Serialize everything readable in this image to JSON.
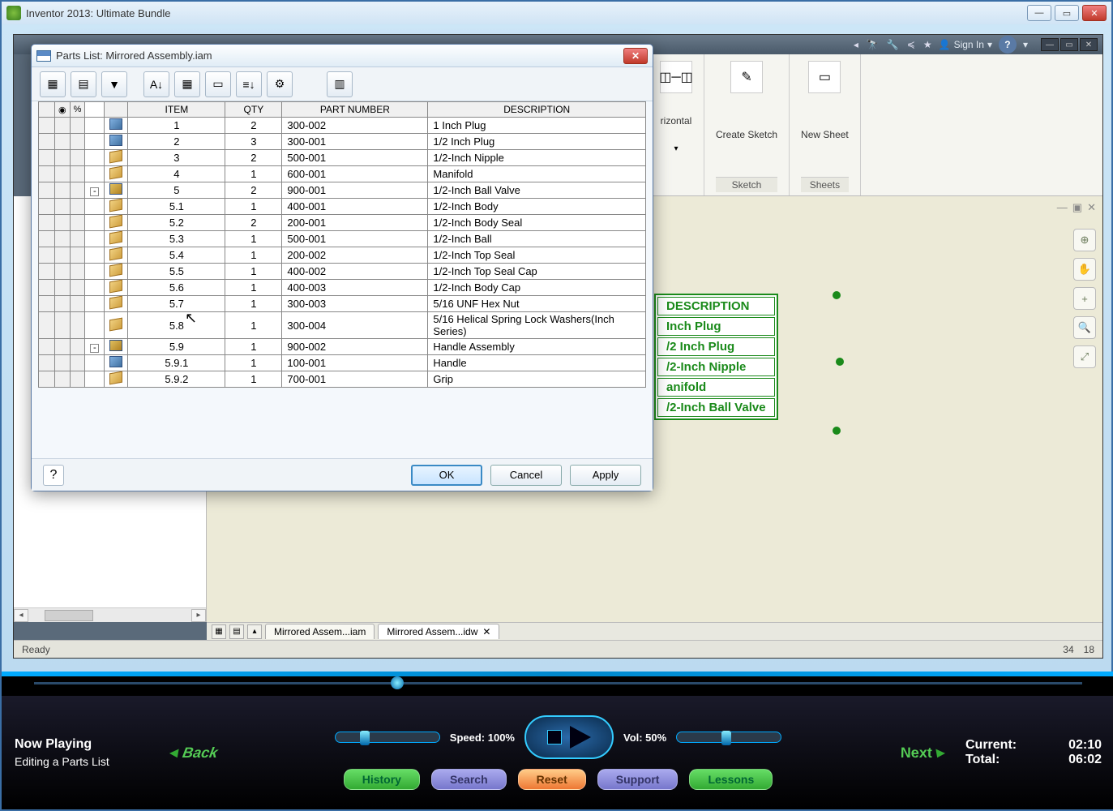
{
  "outer": {
    "title": "Inventor 2013: Ultimate Bundle"
  },
  "inner": {
    "signin": "Sign In",
    "ribbon": {
      "horizontal": "rizontal",
      "createSketch": "Create Sketch",
      "newSheet": "New Sheet",
      "sketchCat": "Sketch",
      "sheetsCat": "Sheets"
    },
    "tabs": {
      "t1": "Mirrored Assem...iam",
      "t2": "Mirrored Assem...idw"
    },
    "status": {
      "ready": "Ready",
      "c1": "34",
      "c2": "18"
    }
  },
  "dwg": {
    "header": "DESCRIPTION",
    "rows": [
      "Inch Plug",
      "/2 Inch Plug",
      "/2-Inch Nipple",
      "anifold",
      "/2-Inch Ball Valve"
    ]
  },
  "dialog": {
    "title": "Parts List: Mirrored Assembly.iam",
    "headers": {
      "item": "ITEM",
      "qty": "QTY",
      "pn": "PART NUMBER",
      "desc": "DESCRIPTION"
    },
    "rows": [
      {
        "exp": "",
        "iconType": "asm",
        "item": "1",
        "qty": "2",
        "pn": "300-002",
        "desc": "1 Inch Plug"
      },
      {
        "exp": "",
        "iconType": "asm",
        "item": "2",
        "qty": "3",
        "pn": "300-001",
        "desc": "1/2 Inch Plug"
      },
      {
        "exp": "",
        "iconType": "box",
        "item": "3",
        "qty": "2",
        "pn": "500-001",
        "desc": "1/2-Inch Nipple"
      },
      {
        "exp": "",
        "iconType": "box",
        "item": "4",
        "qty": "1",
        "pn": "600-001",
        "desc": "Manifold"
      },
      {
        "exp": "-",
        "iconType": "sub",
        "item": "5",
        "qty": "2",
        "pn": "900-001",
        "desc": "1/2-Inch Ball Valve"
      },
      {
        "exp": "",
        "iconType": "box",
        "item": "5.1",
        "qty": "1",
        "pn": "400-001",
        "desc": "1/2-Inch Body"
      },
      {
        "exp": "",
        "iconType": "box",
        "item": "5.2",
        "qty": "2",
        "pn": "200-001",
        "desc": "1/2-Inch Body Seal"
      },
      {
        "exp": "",
        "iconType": "box",
        "item": "5.3",
        "qty": "1",
        "pn": "500-001",
        "desc": "1/2-Inch Ball"
      },
      {
        "exp": "",
        "iconType": "box",
        "item": "5.4",
        "qty": "1",
        "pn": "200-002",
        "desc": "1/2-Inch Top Seal"
      },
      {
        "exp": "",
        "iconType": "box",
        "item": "5.5",
        "qty": "1",
        "pn": "400-002",
        "desc": "1/2-Inch Top Seal Cap"
      },
      {
        "exp": "",
        "iconType": "box",
        "item": "5.6",
        "qty": "1",
        "pn": "400-003",
        "desc": "1/2-Inch Body Cap"
      },
      {
        "exp": "",
        "iconType": "box",
        "item": "5.7",
        "qty": "1",
        "pn": "300-003",
        "desc": "5/16 UNF Hex Nut"
      },
      {
        "exp": "",
        "iconType": "box",
        "item": "5.8",
        "qty": "1",
        "pn": "300-004",
        "desc": "5/16  Helical Spring Lock Washers(Inch Series)"
      },
      {
        "exp": "-",
        "iconType": "sub",
        "item": "5.9",
        "qty": "1",
        "pn": "900-002",
        "desc": "Handle Assembly"
      },
      {
        "exp": "",
        "iconType": "asm",
        "item": "5.9.1",
        "qty": "1",
        "pn": "100-001",
        "desc": "Handle"
      },
      {
        "exp": "",
        "iconType": "box",
        "item": "5.9.2",
        "qty": "1",
        "pn": "700-001",
        "desc": "Grip"
      }
    ],
    "buttons": {
      "ok": "OK",
      "cancel": "Cancel",
      "apply": "Apply"
    }
  },
  "player": {
    "nowPlayingTitle": "Now Playing",
    "nowPlayingSub": "Editing a Parts List",
    "back": "Back",
    "next": "Next",
    "speedLabel": "Speed: 100%",
    "volLabel": "Vol: 50%",
    "buttons": {
      "history": "History",
      "search": "Search",
      "reset": "Reset",
      "support": "Support",
      "lessons": "Lessons"
    },
    "currentLabel": "Current:",
    "currentVal": "02:10",
    "totalLabel": "Total:",
    "totalVal": "06:02"
  }
}
